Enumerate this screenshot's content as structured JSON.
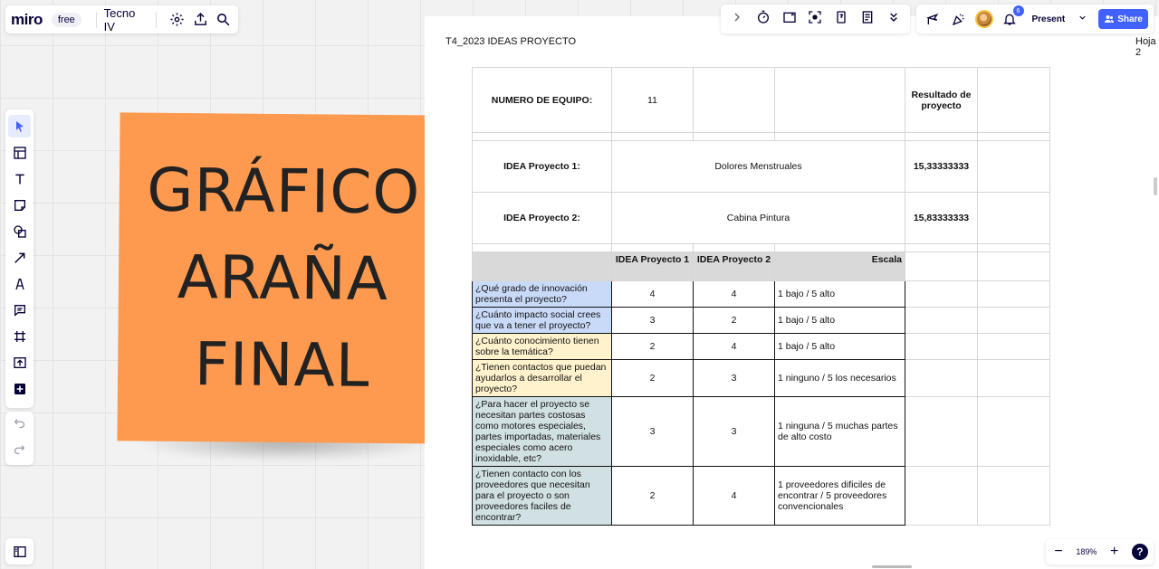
{
  "toolbar": {
    "logo": "miro",
    "plan": "free",
    "board_name": "Tecno IV"
  },
  "sticky_note": {
    "text": "GRÁFICO\nARAÑA\nFINAL",
    "color": "#fe9a4f"
  },
  "sheet": {
    "title": "T4_2023 IDEAS PROYECTO",
    "tab": "Hoja 2",
    "team_label": "NUMERO DE EQUIPO:",
    "team_number": "11",
    "result_header": "Resultado de proyecto",
    "ideas": [
      {
        "label": "IDEA Proyecto 1:",
        "name": "Dolores Menstruales",
        "score": "15,33333333"
      },
      {
        "label": "IDEA Proyecto 2:",
        "name": "Cabina Pintura",
        "score": "15,83333333"
      }
    ],
    "columns": [
      "IDEA Proyecto 1",
      "IDEA Proyecto 2",
      "Escala"
    ],
    "rows": [
      {
        "question": "¿Qué grado de innovación presenta el proyecto?",
        "p1": "4",
        "p2": "4",
        "scale": "1 bajo / 5 alto"
      },
      {
        "question": "¿Cuánto impacto social crees que va a tener el proyecto?",
        "p1": "3",
        "p2": "2",
        "scale": "1 bajo / 5 alto"
      },
      {
        "question": "¿Cuánto conocimiento tienen sobre la temática?",
        "p1": "2",
        "p2": "4",
        "scale": "1 bajo / 5 alto"
      },
      {
        "question": "¿Tienen contactos que puedan ayudarlos a desarrollar el proyecto?",
        "p1": "2",
        "p2": "3",
        "scale": "1 ninguno / 5 los necesarios"
      },
      {
        "question": "¿Para hacer el proyecto se necesitan partes costosas como motores especiales, partes importadas, materiales especiales como acero inoxidable, etc?",
        "p1": "3",
        "p2": "3",
        "scale": "1 ninguna / 5 muchas partes de alto costo"
      },
      {
        "question": "¿Tienen contacto con los proveedores que necesitan para el proyecto o son proveedores faciles de encontrar?",
        "p1": "2",
        "p2": "4",
        "scale": "1 proveedores dificiles de encontrar / 5 proveedores convencionales"
      }
    ]
  },
  "top_right": {
    "notification_count": "6",
    "present_label": "Present",
    "share_label": "Share"
  },
  "zoom": {
    "level": "189%",
    "minus": "−",
    "plus": "+",
    "help": "?"
  },
  "colors": {
    "accent": "#4262ff",
    "ink": "#050038",
    "row_blue": "#c9daf8",
    "row_yellow": "#fff2cc",
    "row_teal": "#d0e0e3",
    "header_gray": "#d9d9d9"
  }
}
